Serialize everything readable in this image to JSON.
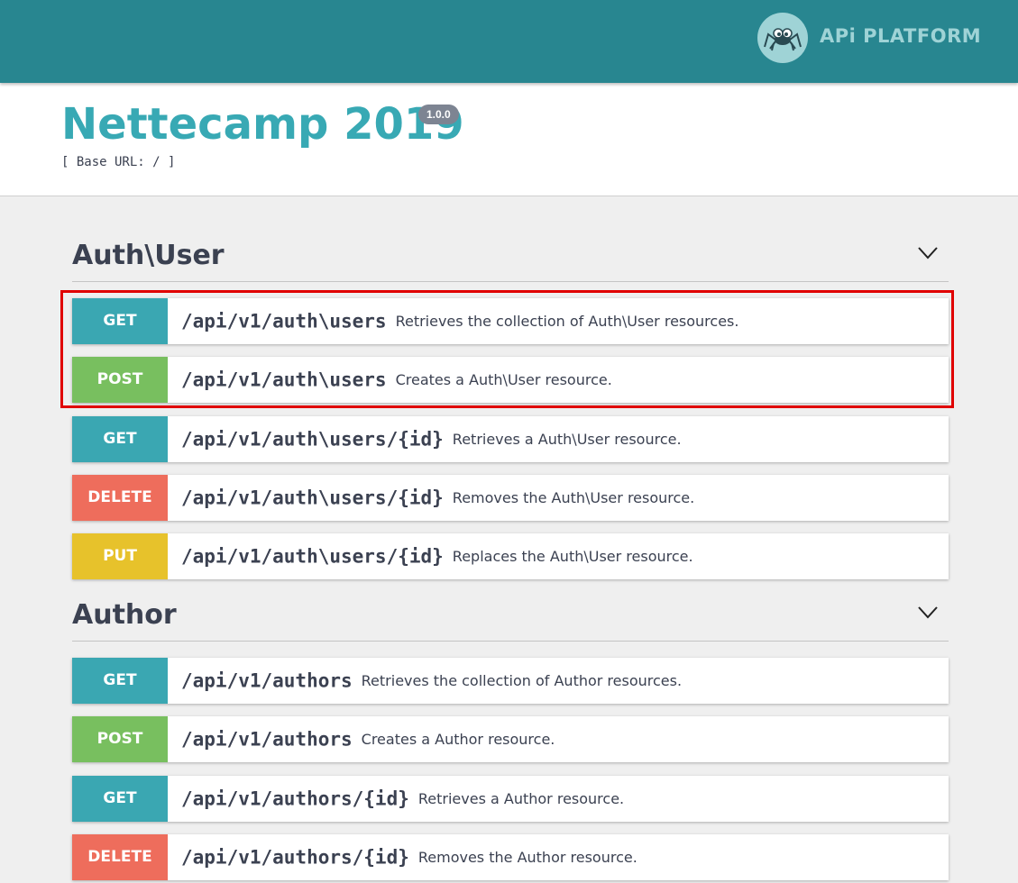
{
  "brand": {
    "logo_text": "APi PLATFORM",
    "logo_icon": "spider-logo-icon",
    "bar_color": "#288690"
  },
  "info": {
    "title": "Nettecamp 2019",
    "version": "1.0.0",
    "base_url": "[ Base URL: / ]"
  },
  "colors": {
    "GET": "#3aa7b2",
    "POST": "#78bf5f",
    "DELETE": "#ee6d5c",
    "PUT": "#e7c22b",
    "highlight": "#e00000"
  },
  "sections": [
    {
      "title": "Auth\\User",
      "chevron_icon": "chevron-down-icon",
      "operations": [
        {
          "method": "GET",
          "path": "/api/v1/auth\\users",
          "summary": "Retrieves the collection of Auth\\User resources."
        },
        {
          "method": "POST",
          "path": "/api/v1/auth\\users",
          "summary": "Creates a Auth\\User resource."
        },
        {
          "method": "GET",
          "path": "/api/v1/auth\\users/{id}",
          "summary": "Retrieves a Auth\\User resource."
        },
        {
          "method": "DELETE",
          "path": "/api/v1/auth\\users/{id}",
          "summary": "Removes the Auth\\User resource."
        },
        {
          "method": "PUT",
          "path": "/api/v1/auth\\users/{id}",
          "summary": "Replaces the Auth\\User resource."
        }
      ]
    },
    {
      "title": "Author",
      "chevron_icon": "chevron-down-icon",
      "operations": [
        {
          "method": "GET",
          "path": "/api/v1/authors",
          "summary": "Retrieves the collection of Author resources."
        },
        {
          "method": "POST",
          "path": "/api/v1/authors",
          "summary": "Creates a Author resource."
        },
        {
          "method": "GET",
          "path": "/api/v1/authors/{id}",
          "summary": "Retrieves a Author resource."
        },
        {
          "method": "DELETE",
          "path": "/api/v1/authors/{id}",
          "summary": "Removes the Author resource."
        }
      ]
    }
  ]
}
